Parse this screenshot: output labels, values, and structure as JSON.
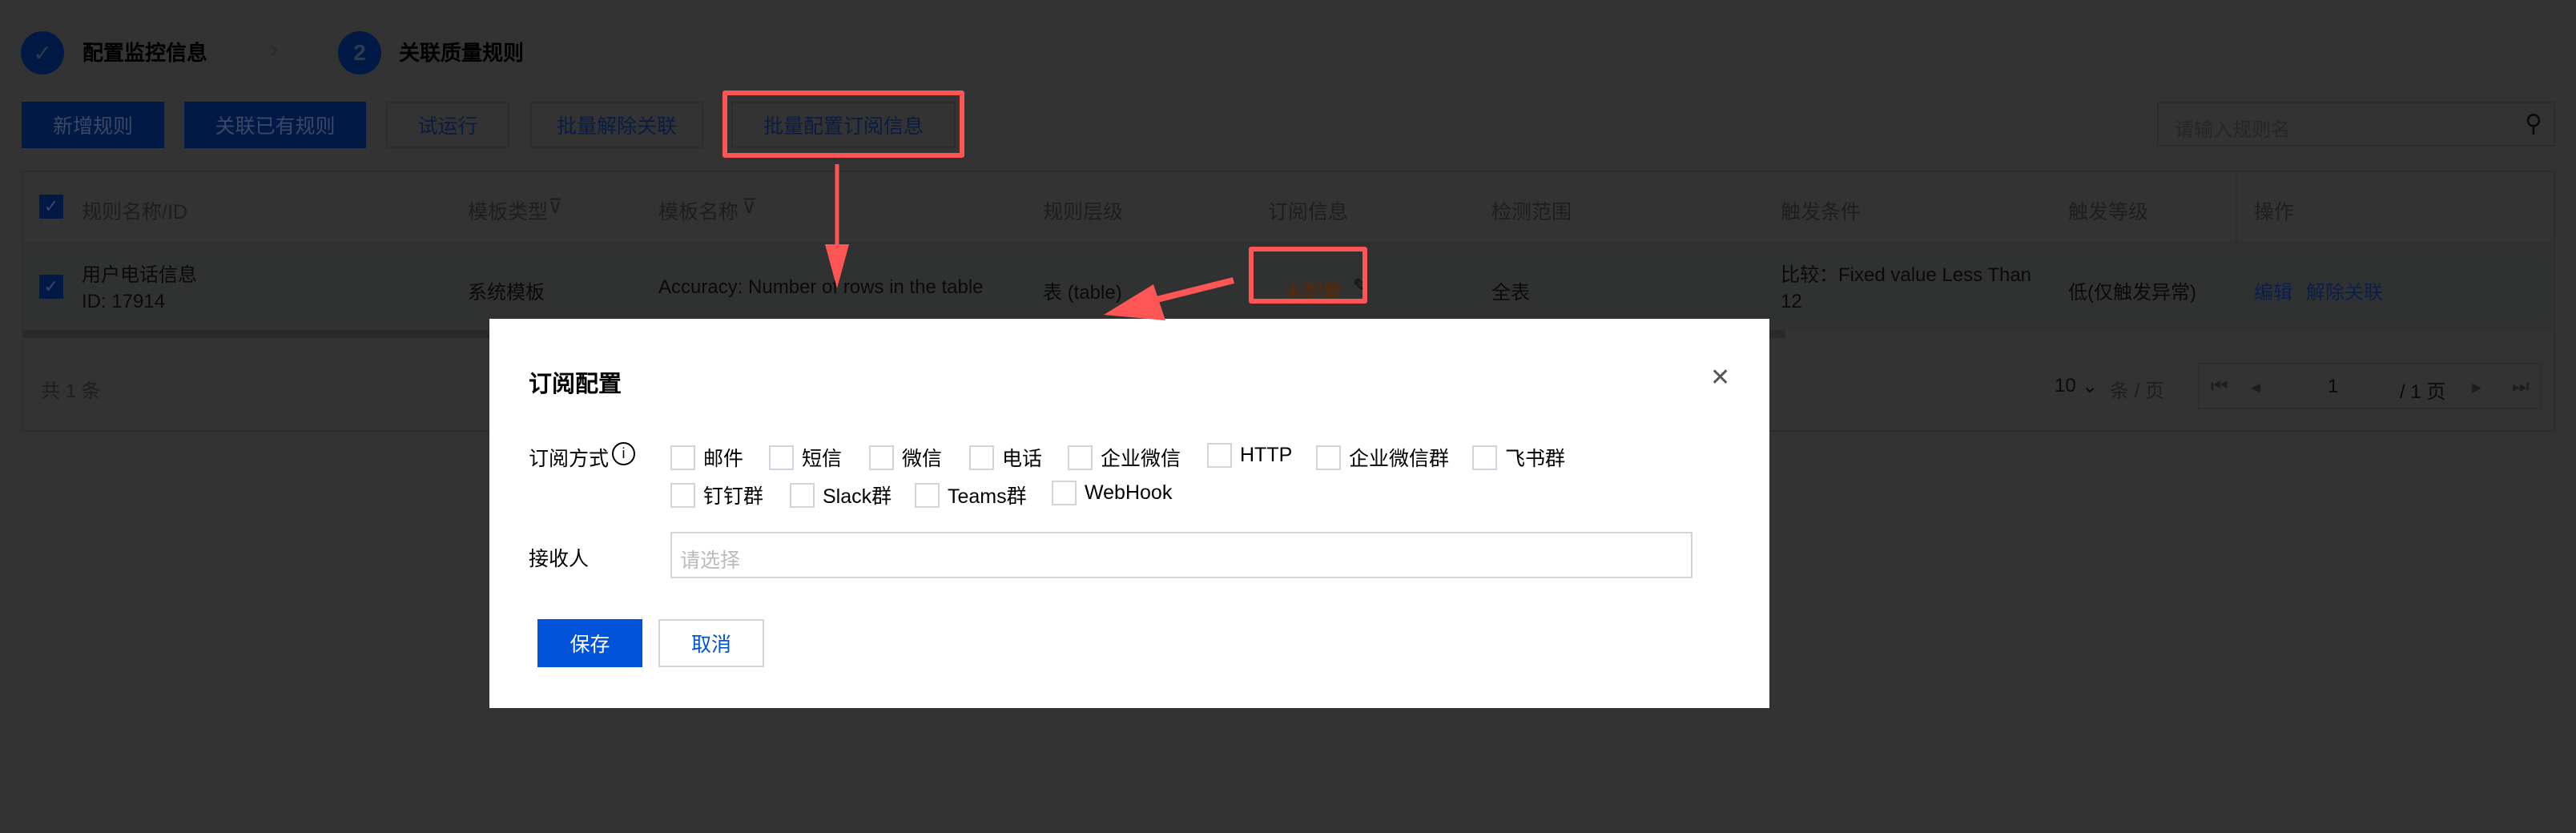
{
  "steps": [
    {
      "label": "配置监控信息",
      "status": "done"
    },
    {
      "number": "2",
      "label": "关联质量规则",
      "status": "active"
    }
  ],
  "toolbar": {
    "add_rule": "新增规则",
    "link_existing": "关联已有规则",
    "trial_run": "试运行",
    "batch_unlink": "批量解除关联",
    "batch_subscribe": "批量配置订阅信息",
    "search_placeholder": "请输入规则名"
  },
  "table": {
    "headers": [
      "规则名称/ID",
      "模板类型",
      "模板名称",
      "规则层级",
      "订阅信息",
      "检测范围",
      "触发条件",
      "触发等级",
      "操作"
    ],
    "rows": [
      {
        "name": "用户电话信息",
        "id": "ID: 17914",
        "template_type": "系统模板",
        "template_name": "Accuracy: Number of rows in the table",
        "level": "表 (table)",
        "subscription": "未配置",
        "scope": "全表",
        "condition_line1": "比较：Fixed value Less Than",
        "condition_line2": "12",
        "trigger_level": "低(仅触发异常)",
        "actions": [
          "编辑",
          "解除关联"
        ]
      }
    ],
    "total": "共 1 条",
    "page_size": "10",
    "page_size_unit": "条 / 页",
    "current_page": "1",
    "total_pages": "/ 1 页"
  },
  "modal": {
    "title": "订阅配置",
    "subscribe_label": "订阅方式",
    "options": [
      "邮件",
      "短信",
      "微信",
      "电话",
      "企业微信",
      "HTTP",
      "企业微信群",
      "飞书群",
      "钉钉群",
      "Slack群",
      "Teams群",
      "WebHook"
    ],
    "receiver_label": "接收人",
    "receiver_placeholder": "请选择",
    "save": "保存",
    "cancel": "取消"
  },
  "colors": {
    "primary": "#0052d9",
    "annotation": "#ff5555",
    "warning": "#e37318"
  }
}
